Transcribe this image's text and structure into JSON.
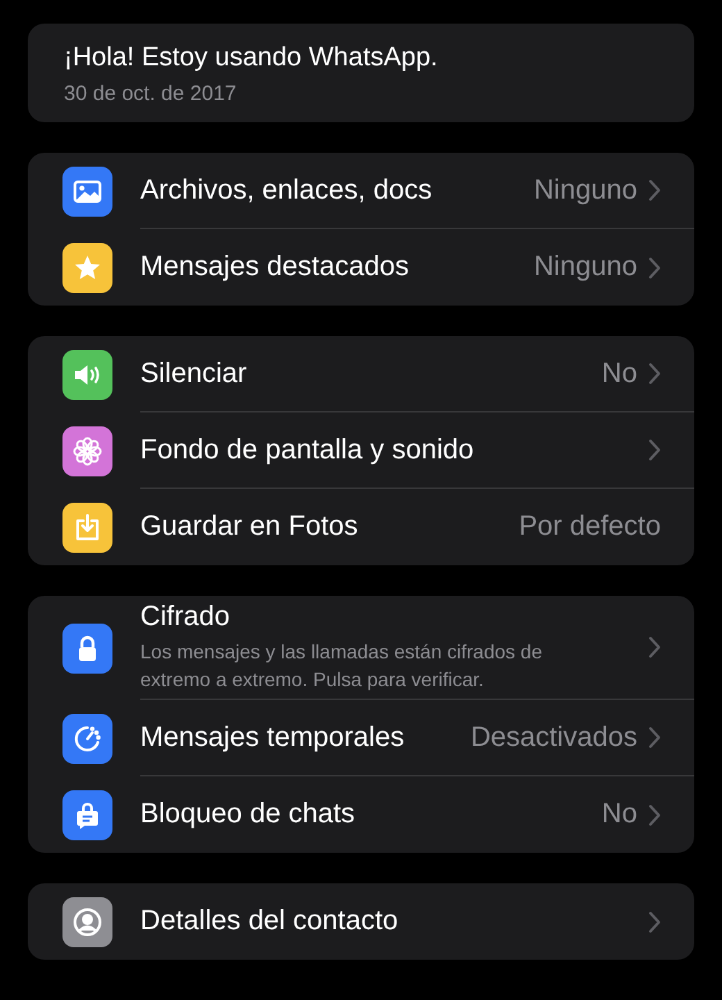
{
  "status": {
    "text": "¡Hola! Estoy usando WhatsApp.",
    "date": "30 de oct. de 2017"
  },
  "groups": [
    {
      "rows": [
        {
          "kind": "image",
          "color": "#3478f6",
          "title": "Archivos, enlaces, docs",
          "value": "Ninguno",
          "chevron": true
        },
        {
          "kind": "star",
          "color": "#f7c33a",
          "title": "Mensajes destacados",
          "value": "Ninguno",
          "chevron": true
        }
      ]
    },
    {
      "rows": [
        {
          "kind": "speaker",
          "color": "#54c15b",
          "title": "Silenciar",
          "value": "No",
          "chevron": true
        },
        {
          "kind": "flower",
          "color": "#d374d8",
          "title": "Fondo de pantalla y sonido",
          "chevron": true
        },
        {
          "kind": "download",
          "color": "#f7c33a",
          "title": "Guardar en Fotos",
          "value": "Por defecto",
          "chevron": false
        }
      ]
    },
    {
      "rows": [
        {
          "kind": "lock",
          "color": "#3478f6",
          "title": "Cifrado",
          "subtitle": "Los mensajes y las llamadas están cifrados de extremo a extremo. Pulsa para verificar.",
          "chevron": true
        },
        {
          "kind": "timer",
          "color": "#3478f6",
          "title": "Mensajes temporales",
          "value": "Desactivados",
          "chevron": true
        },
        {
          "kind": "chatlock",
          "color": "#3478f6",
          "title": "Bloqueo de chats",
          "value": "No",
          "chevron": true
        }
      ]
    },
    {
      "rows": [
        {
          "kind": "person",
          "color": "#8e8e93",
          "title": "Detalles del contacto",
          "chevron": true
        }
      ]
    }
  ]
}
